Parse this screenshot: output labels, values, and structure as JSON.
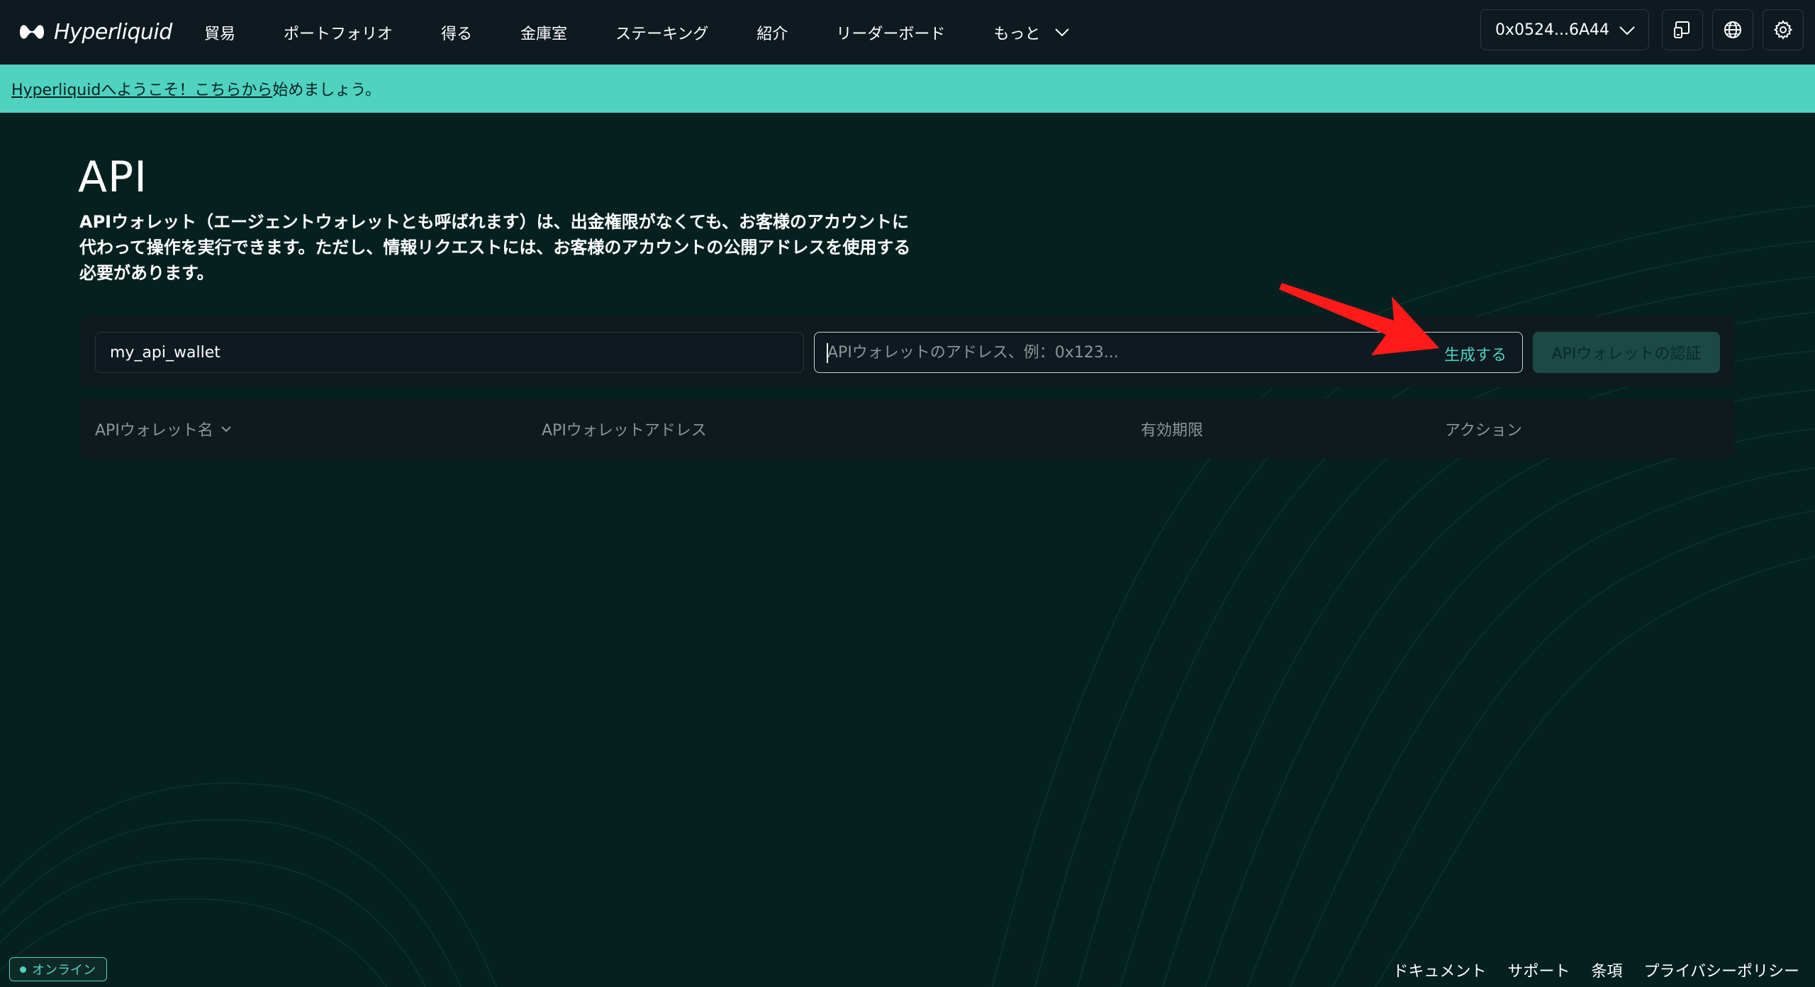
{
  "brand": {
    "name": "Hyperliquid"
  },
  "nav": {
    "items": [
      {
        "label": "貿易"
      },
      {
        "label": "ポートフォリオ"
      },
      {
        "label": "得る"
      },
      {
        "label": "金庫室"
      },
      {
        "label": "ステーキング"
      },
      {
        "label": "紹介"
      },
      {
        "label": "リーダーボード"
      }
    ],
    "more_label": "もっと",
    "wallet_address": "0x0524...6A44"
  },
  "banner": {
    "link_text": "Hyperliquidへようこそ！こちらから",
    "rest_text": "始めましょう。"
  },
  "page": {
    "title": "API",
    "description": "APIウォレット（エージェントウォレットとも呼ばれます）は、出金権限がなくても、お客様のアカウントに代わって操作を実行できます。ただし、情報リクエストには、お客様のアカウントの公開アドレスを使用する必要があります。"
  },
  "form": {
    "name_value": "my_api_wallet",
    "address_value": "",
    "address_placeholder": "APIウォレットのアドレス、例：0x123...",
    "generate_label": "生成する",
    "authorize_label": "APIウォレットの認証"
  },
  "table": {
    "columns": [
      "APIウォレット名",
      "APIウォレットアドレス",
      "有効期限",
      "アクション"
    ],
    "rows": []
  },
  "footer": {
    "status": "オンライン",
    "links": [
      "ドキュメント",
      "サポート",
      "条項",
      "プライバシーポリシー"
    ]
  },
  "colors": {
    "background": "#04211f",
    "nav_background": "#0e1a20",
    "accent": "#50d2c1",
    "annotation_arrow": "#ff1a1a"
  }
}
